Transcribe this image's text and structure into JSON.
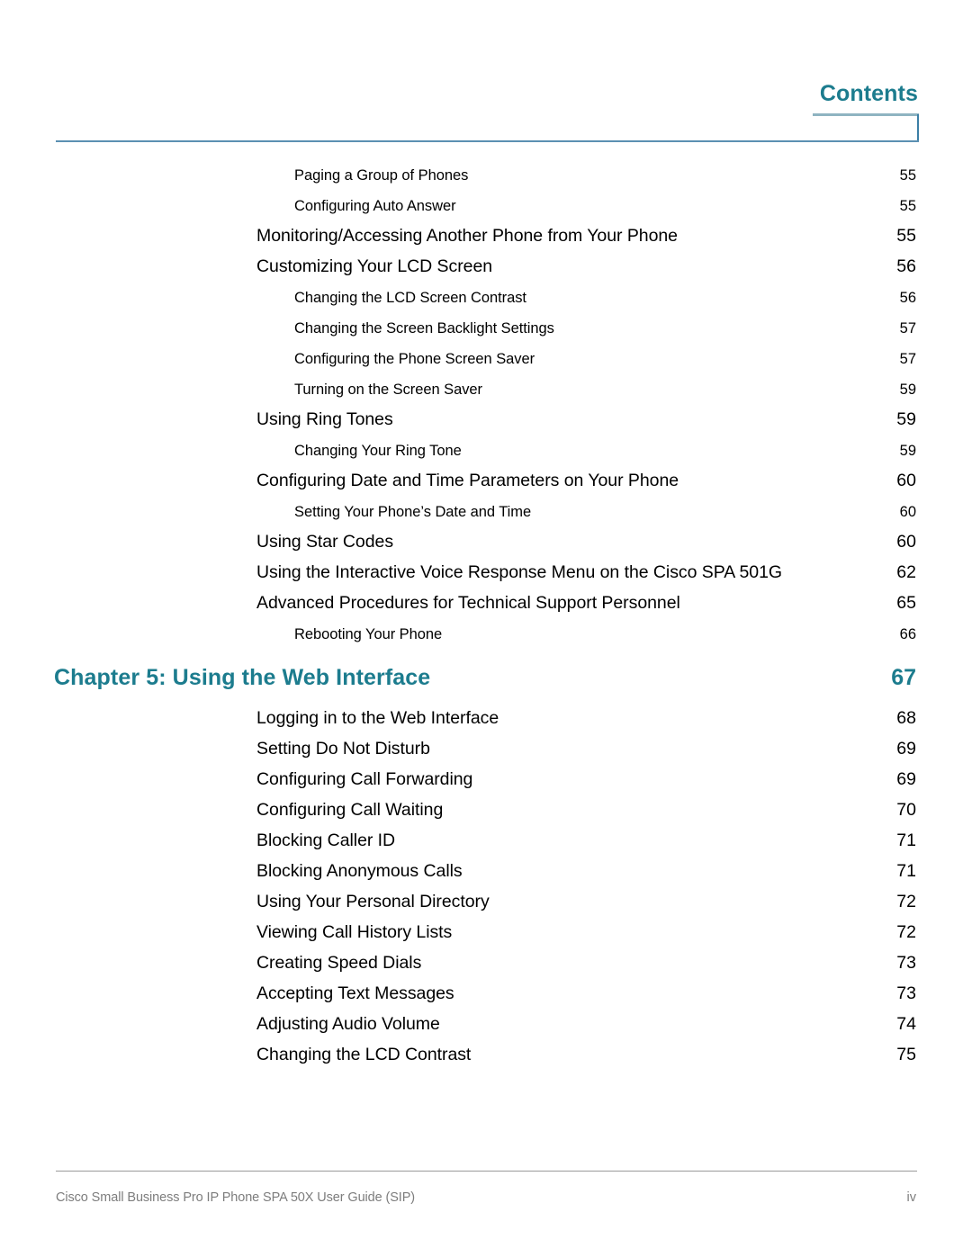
{
  "header": {
    "title": "Contents",
    "accent_color": "#1c7c8e",
    "rule_color": "#5b90b2",
    "underline_color": "#8fb4c1"
  },
  "toc": {
    "entries": [
      {
        "level": 2,
        "label": "Paging a Group of Phones",
        "page": "55"
      },
      {
        "level": 2,
        "label": "Configuring Auto Answer",
        "page": "55"
      },
      {
        "level": 1,
        "label": "Monitoring/Accessing Another Phone from Your Phone",
        "page": "55"
      },
      {
        "level": 1,
        "label": "Customizing Your LCD Screen",
        "page": "56"
      },
      {
        "level": 2,
        "label": "Changing the LCD Screen Contrast",
        "page": "56"
      },
      {
        "level": 2,
        "label": "Changing the Screen Backlight Settings",
        "page": "57"
      },
      {
        "level": 2,
        "label": "Configuring the Phone Screen Saver",
        "page": "57"
      },
      {
        "level": 2,
        "label": "Turning on the Screen Saver",
        "page": "59"
      },
      {
        "level": 1,
        "label": "Using Ring Tones",
        "page": "59"
      },
      {
        "level": 2,
        "label": "Changing Your Ring Tone",
        "page": "59"
      },
      {
        "level": 1,
        "label": "Configuring Date and Time Parameters on Your Phone",
        "page": "60"
      },
      {
        "level": 2,
        "label": "Setting Your Phone’s Date and Time",
        "page": "60"
      },
      {
        "level": 1,
        "label": "Using Star Codes",
        "page": "60"
      },
      {
        "level": 1,
        "label": "Using the Interactive Voice Response Menu on the Cisco SPA 501G",
        "page": "62"
      },
      {
        "level": 1,
        "label": "Advanced Procedures for Technical Support Personnel",
        "page": "65"
      },
      {
        "level": 2,
        "label": "Rebooting Your Phone",
        "page": "66"
      },
      {
        "level": 0,
        "label": "Chapter 5: Using the Web Interface",
        "page": "67"
      },
      {
        "level": 1,
        "label": "Logging in to the Web Interface",
        "page": "68"
      },
      {
        "level": 1,
        "label": "Setting Do Not Disturb",
        "page": "69"
      },
      {
        "level": 1,
        "label": "Configuring Call Forwarding",
        "page": "69"
      },
      {
        "level": 1,
        "label": "Configuring Call Waiting",
        "page": "70"
      },
      {
        "level": 1,
        "label": "Blocking Caller ID",
        "page": "71"
      },
      {
        "level": 1,
        "label": "Blocking Anonymous Calls",
        "page": "71"
      },
      {
        "level": 1,
        "label": "Using Your Personal Directory",
        "page": "72"
      },
      {
        "level": 1,
        "label": "Viewing Call History Lists",
        "page": "72"
      },
      {
        "level": 1,
        "label": "Creating Speed Dials",
        "page": "73"
      },
      {
        "level": 1,
        "label": "Accepting Text Messages",
        "page": "73"
      },
      {
        "level": 1,
        "label": "Adjusting Audio Volume",
        "page": "74"
      },
      {
        "level": 1,
        "label": "Changing the LCD Contrast",
        "page": "75"
      }
    ]
  },
  "footer": {
    "document_title": "Cisco Small Business Pro IP Phone SPA 50X User Guide (SIP)",
    "page_number": "iv",
    "text_color": "#7d7d7d"
  }
}
